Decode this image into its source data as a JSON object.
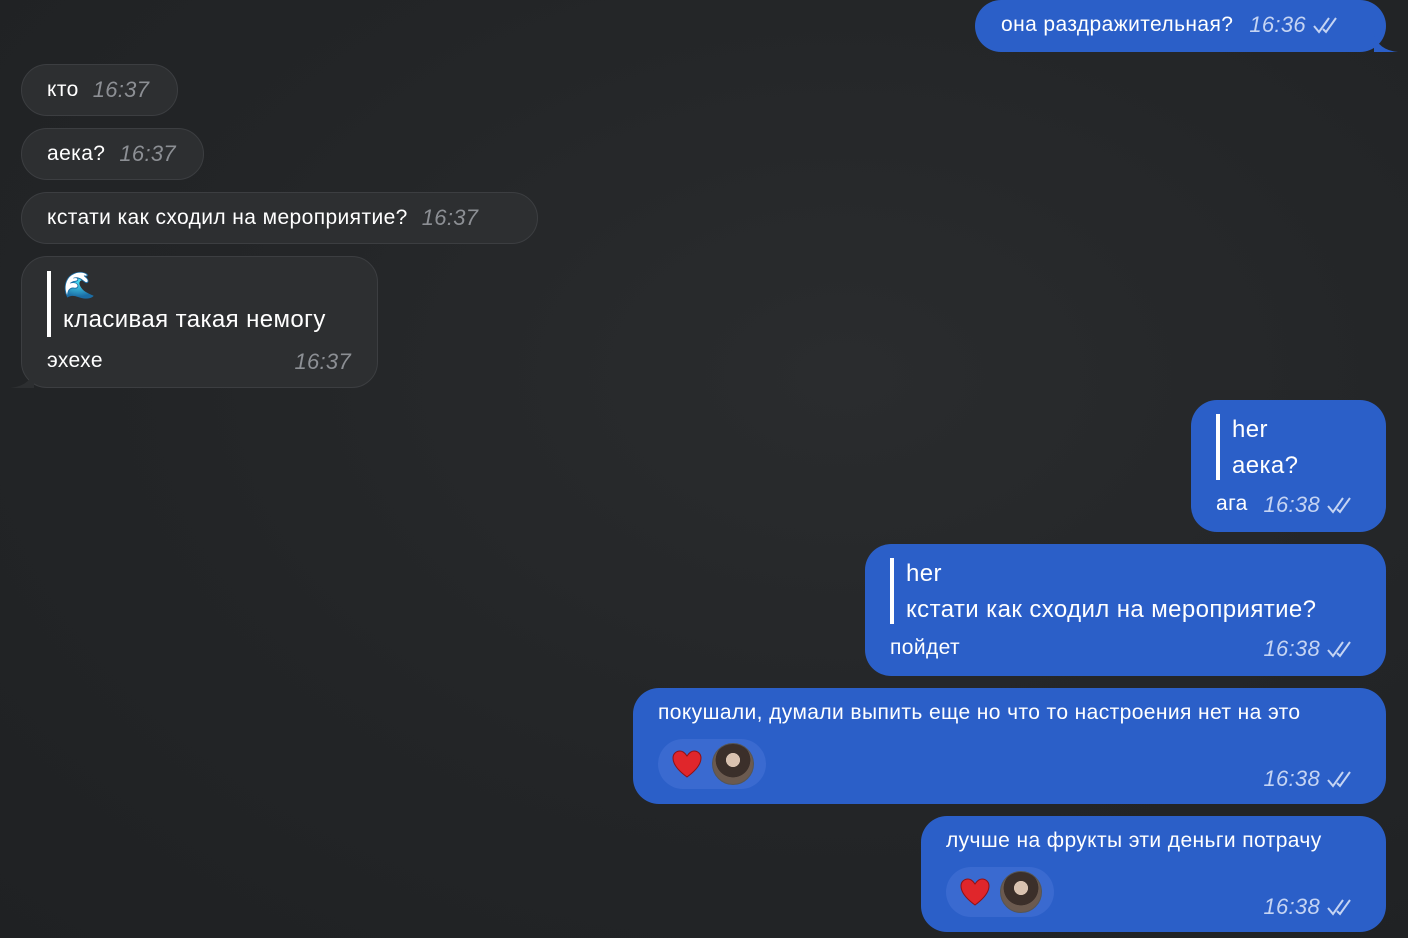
{
  "messages": {
    "m1": {
      "text": "она раздражительная?",
      "time": "16:36"
    },
    "m2": {
      "text": "кто",
      "time": "16:37"
    },
    "m3": {
      "text": "аека?",
      "time": "16:37"
    },
    "m4": {
      "text": "кстати как сходил на мероприятие?",
      "time": "16:37"
    },
    "m5": {
      "quote_emoji": "🌊",
      "quote_text": "класивая такая немогу",
      "text": "эхехе",
      "time": "16:37"
    },
    "m6": {
      "quote_author": "her",
      "quote_text": "аека?",
      "text": "ага",
      "time": "16:38"
    },
    "m7": {
      "quote_author": "her",
      "quote_text": "кстати как сходил на мероприятие?",
      "text": "пойдет",
      "time": "16:38"
    },
    "m8": {
      "text": "покушали, думали выпить еще но что то настроения нет на это",
      "time": "16:38",
      "reaction": "heart-icon"
    },
    "m9": {
      "text": "лучше на фрукты эти деньги потрачу",
      "time": "16:38",
      "reaction": "heart-icon"
    }
  },
  "colors": {
    "background": "#232527",
    "incoming_bubble": "#2d2f31",
    "outgoing_bubble": "#2b5fc8",
    "reaction_heart": "#e0262b"
  }
}
